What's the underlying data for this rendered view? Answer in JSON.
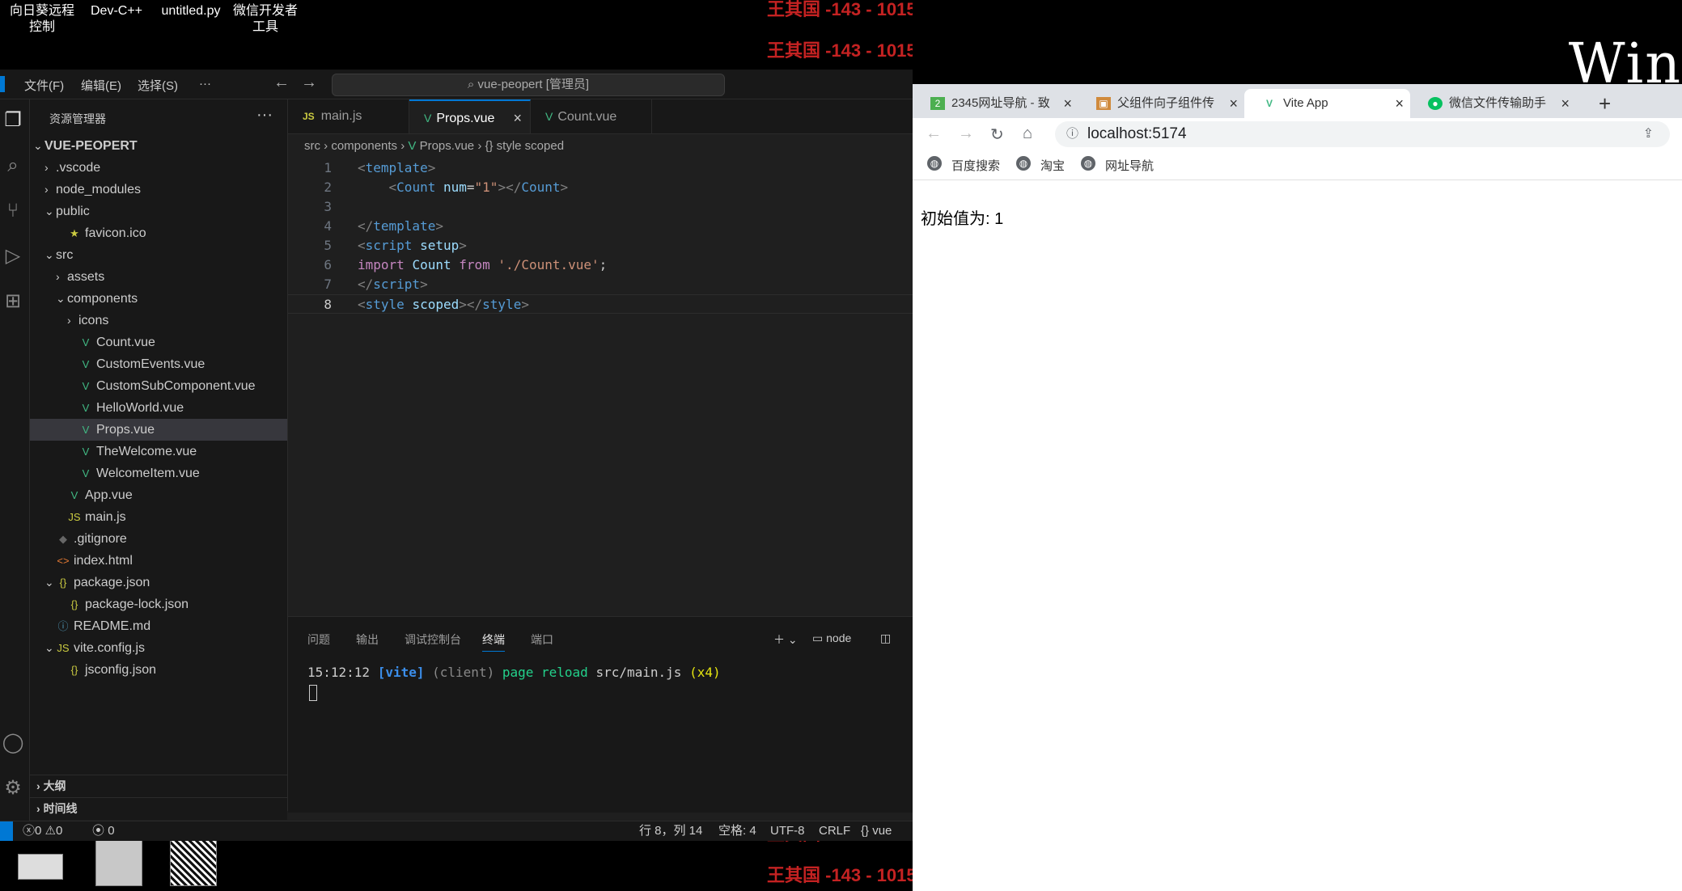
{
  "desktop": {
    "icons": [
      {
        "label_line1": "向日葵远程",
        "label_line2": "控制"
      },
      {
        "label_line1": "Dev-C++",
        "label_line2": ""
      },
      {
        "label_line1": "untitled.py",
        "label_line2": ""
      },
      {
        "label_line1": "微信开发者",
        "label_line2": "工具"
      }
    ],
    "win_text": "Win",
    "watermark": "王其国 -143 - 1015"
  },
  "vscode": {
    "menu": [
      "文件(F)",
      "编辑(E)",
      "选择(S)",
      "···"
    ],
    "search_text": "vue-peopert [管理员]",
    "sidebar_title": "资源管理器",
    "sidebar_more": "···",
    "root": "VUE-PEOPERT",
    "tree": [
      {
        "label": "VUE-PEOPERT",
        "icon": "",
        "chev": "⌄"
      },
      {
        "label": ".vscode",
        "icon": "",
        "chev": "›"
      },
      {
        "label": "node_modules",
        "icon": "",
        "chev": "›"
      },
      {
        "label": "public",
        "icon": "",
        "chev": "⌄"
      },
      {
        "label": "favicon.ico",
        "icon": "★",
        "chev": ""
      },
      {
        "label": "src",
        "icon": "",
        "chev": "⌄"
      },
      {
        "label": "assets",
        "icon": "",
        "chev": "›"
      },
      {
        "label": "components",
        "icon": "",
        "chev": "⌄"
      },
      {
        "label": "icons",
        "icon": "",
        "chev": "›"
      },
      {
        "label": "Count.vue",
        "icon": "V",
        "chev": ""
      },
      {
        "label": "CustomEvents.vue",
        "icon": "V",
        "chev": ""
      },
      {
        "label": "CustomSubComponent.vue",
        "icon": "V",
        "chev": ""
      },
      {
        "label": "HelloWorld.vue",
        "icon": "V",
        "chev": ""
      },
      {
        "label": "Props.vue",
        "icon": "V",
        "chev": ""
      },
      {
        "label": "TheWelcome.vue",
        "icon": "V",
        "chev": ""
      },
      {
        "label": "WelcomeItem.vue",
        "icon": "V",
        "chev": ""
      },
      {
        "label": "App.vue",
        "icon": "V",
        "chev": ""
      },
      {
        "label": "main.js",
        "icon": "JS",
        "chev": ""
      },
      {
        "label": ".gitignore",
        "icon": "◆",
        "chev": ""
      },
      {
        "label": "index.html",
        "icon": "<>",
        "chev": ""
      },
      {
        "label": "package.json",
        "icon": "{}",
        "chev": "⌄"
      },
      {
        "label": "package-lock.json",
        "icon": "{}",
        "chev": ""
      },
      {
        "label": "README.md",
        "icon": "ⓘ",
        "chev": ""
      },
      {
        "label": "vite.config.js",
        "icon": "JS",
        "chev": "⌄"
      },
      {
        "label": "jsconfig.json",
        "icon": "{}",
        "chev": ""
      }
    ],
    "outline": "大纲",
    "timeline": "时间线",
    "tabs": [
      "main.js",
      "Props.vue",
      "Count.vue"
    ],
    "breadcrumb": {
      "a": "src",
      "b": "components",
      "c": "Props.vue",
      "d": "{} style scoped"
    },
    "code_lines": [
      "1",
      "2",
      "3",
      "4",
      "5",
      "6",
      "7",
      "8"
    ],
    "code_text": {
      "template_open": "template",
      "count_tag": "Count",
      "count_attr": "num",
      "count_val": "\"1\"",
      "template_close": "template",
      "script": "script",
      "setup": "setup",
      "import": "import",
      "count_id": "Count",
      "from": "from",
      "path": "'./Count.vue'",
      "style": "style",
      "scoped": "scoped"
    },
    "panel_tabs": [
      "问题",
      "输出",
      "调试控制台",
      "终端",
      "端口"
    ],
    "terminal_shell": "node",
    "terminal": {
      "time": "15:12:12",
      "vite": "[vite]",
      "client": "(client)",
      "reload": "page reload",
      "file": "src/main.js",
      "count": "(x4)"
    },
    "status": {
      "errors": "0",
      "warnings": "0",
      "ports": "0",
      "position": "行 8，列 14",
      "spaces": "空格: 4",
      "encoding": "UTF-8",
      "eol": "CRLF",
      "lang": "vue"
    }
  },
  "browser": {
    "tabs": [
      "2345网址导航 - 致",
      "父组件向子组件传",
      "Vite App",
      "微信文件传输助手"
    ],
    "url": "localhost:5174",
    "bookmarks": [
      "百度搜索",
      "淘宝",
      "网址导航"
    ],
    "page_text": "初始值为: 1"
  }
}
